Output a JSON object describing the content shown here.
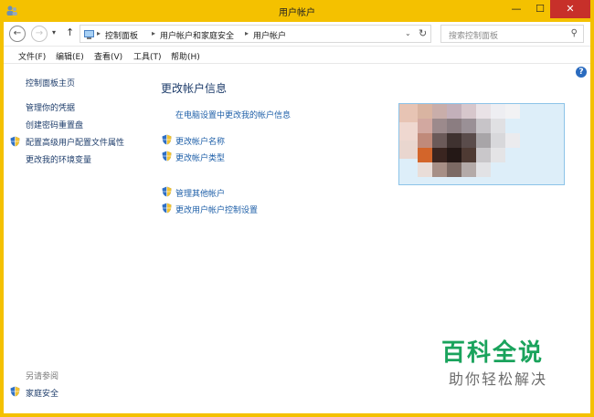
{
  "window": {
    "title": "用户帐户",
    "controls": {
      "minimize": "—",
      "maximize": "☐",
      "close": "✕"
    }
  },
  "nav": {
    "back_glyph": "←",
    "forward_glyph": "→",
    "recent_glyph": "▾",
    "up_glyph": "↑",
    "breadcrumb": [
      "控制面板",
      "用户帐户和家庭安全",
      "用户帐户"
    ],
    "separator": "▸",
    "dropdown_glyph": "⌄",
    "refresh_glyph": "↻"
  },
  "search": {
    "placeholder": "搜索控制面板",
    "icon_glyph": "⚲"
  },
  "menu": [
    "文件(F)",
    "编辑(E)",
    "查看(V)",
    "工具(T)",
    "帮助(H)"
  ],
  "help_glyph": "?",
  "sidebar": {
    "home": "控制面板主页",
    "links": [
      "管理你的凭据",
      "创建密码重置盘",
      "配置高级用户配置文件属性",
      "更改我的环境变量"
    ],
    "see_also_heading": "另请参阅",
    "see_also": [
      "家庭安全"
    ]
  },
  "main": {
    "title": "更改帐户信息",
    "pc_settings_link": "在电脑设置中更改我的帐户信息",
    "account_links": [
      "更改帐户名称",
      "更改帐户类型"
    ],
    "other_links": [
      "管理其他帐户",
      "更改用户帐户控制设置"
    ]
  },
  "watermark": {
    "brand": "百科全说",
    "slogan": "助你轻松解决"
  },
  "colors": {
    "title_bar": "#f4c100",
    "close_button": "#c7302a",
    "link": "#1e5fa8",
    "watermark_green": "#1aa35c"
  },
  "icons": {
    "shield": "uac-shield-icon",
    "control_panel": "control-panel-icon",
    "users": "user-accounts-icon"
  }
}
